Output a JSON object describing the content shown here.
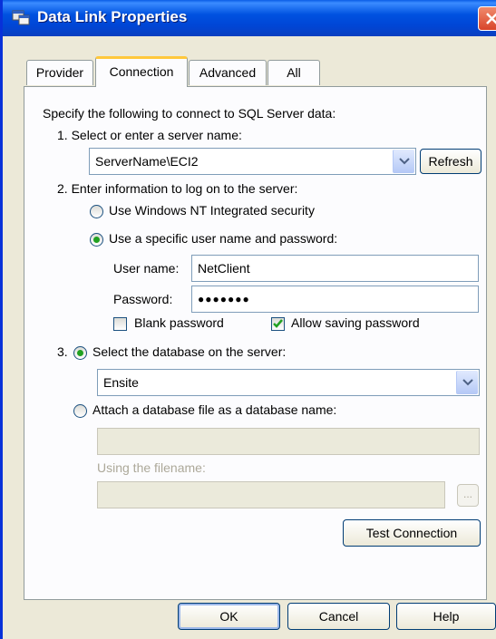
{
  "window": {
    "title": "Data Link Properties"
  },
  "tabs": [
    {
      "label": "Provider"
    },
    {
      "label": "Connection"
    },
    {
      "label": "Advanced"
    },
    {
      "label": "All"
    }
  ],
  "connection": {
    "intro": "Specify the following to connect to SQL Server data:",
    "step1_label": "1. Select or enter a server name:",
    "server_value": "ServerName\\ECI2",
    "refresh_label": "Refresh",
    "step2_label": "2. Enter information to log on to the server:",
    "radio_nt": "Use Windows NT Integrated security",
    "radio_specific": "Use a specific user name and password:",
    "username_label": "User name:",
    "username_value": "NetClient",
    "password_label": "Password:",
    "password_value": "●●●●●●●",
    "blank_password": "Blank password",
    "allow_saving": "Allow saving password",
    "step3_prefix": "3.",
    "radio_select_db": "Select the database on the server:",
    "database_value": "Ensite",
    "radio_attach": "Attach a database file as a database name:",
    "using_filename_label": "Using the filename:",
    "browse_label": "...",
    "test_connection": "Test Connection"
  },
  "footer": {
    "ok": "OK",
    "cancel": "Cancel",
    "help": "Help"
  }
}
